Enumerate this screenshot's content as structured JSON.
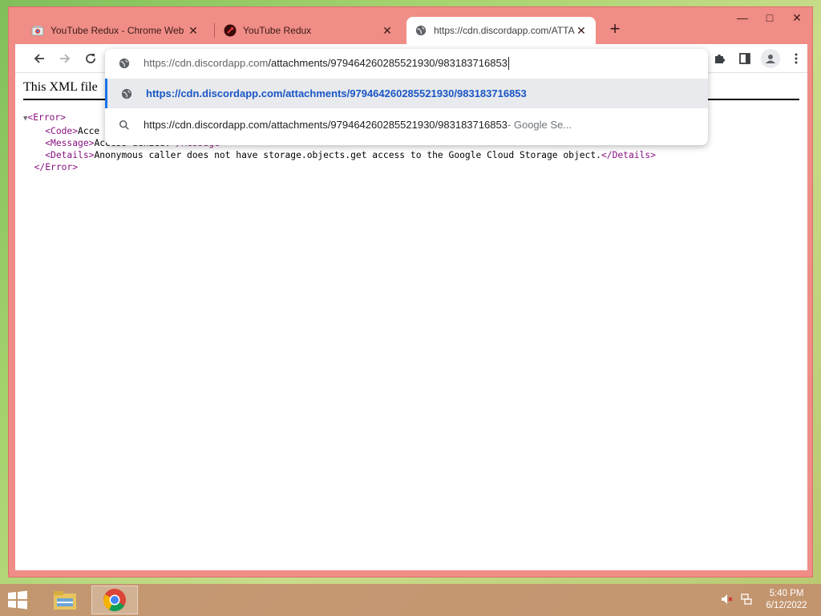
{
  "browser": {
    "tabs": [
      {
        "title": "YouTube Redux - Chrome Web Sto",
        "favicon": "chrome-web-store-icon"
      },
      {
        "title": "YouTube Redux",
        "favicon": "youtube-redux-icon"
      },
      {
        "title": "https://cdn.discordapp.com/ATTACHMENTS",
        "favicon": "globe-icon"
      }
    ],
    "new_tab_label": "+",
    "window_controls": {
      "minimize": "—",
      "maximize": "□",
      "close": "✕"
    }
  },
  "omnibox": {
    "value": "https://cdn.discordapp.com/attachments/979464260285521930/983183716853",
    "value_host": "https://cdn.discordapp.com",
    "value_path": "/attachments/979464260285521930/983183716853",
    "suggestions": [
      {
        "text": "https://cdn.discordapp.com/attachments/979464260285521930/983183716853",
        "hint": "",
        "icon": "globe-icon",
        "selected": true
      },
      {
        "text": "https://cdn.discordapp.com/attachments/979464260285521930/983183716853",
        "hint": " - Google Se...",
        "icon": "search-icon",
        "selected": false
      }
    ]
  },
  "page": {
    "xml_notice": "This XML file",
    "xml": {
      "error_open": "<Error>",
      "code_open": "<Code>",
      "code_text": "Acce",
      "message_open": "<Message>",
      "message_text": "Access denied.",
      "message_close": "</Message>",
      "details_open": "<Details>",
      "details_text": "Anonymous caller does not have storage.objects.get access to the Google Cloud Storage object.",
      "details_close": "</Details>",
      "error_close": "</Error>"
    }
  },
  "taskbar": {
    "apps": [
      "file-explorer-icon",
      "chrome-icon"
    ],
    "time": "5:40 PM",
    "date": "6/12/2022"
  },
  "colors": {
    "frame": "#f08d86",
    "accent_blue": "#1a73e8",
    "xml_tag": "#881280"
  }
}
